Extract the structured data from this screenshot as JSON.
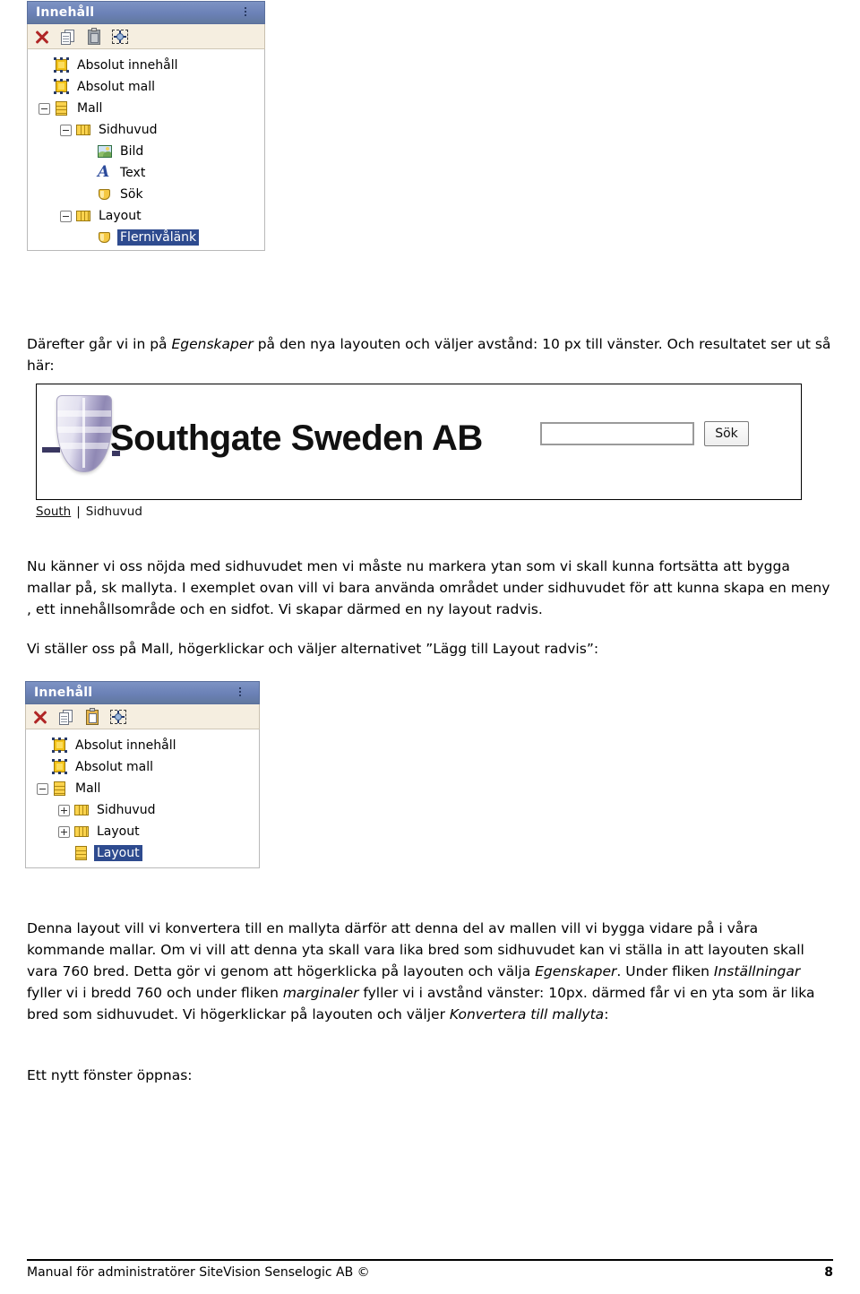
{
  "document": {
    "footer_text": "Manual för administratörer SiteVision Senselogic AB ©",
    "page_number": "8"
  },
  "tree_panel_1": {
    "title": "Innehåll",
    "toolbar": {
      "delete_tooltip": "Ta bort",
      "copy_tooltip": "Kopiera",
      "paste_tooltip": "Klistra in",
      "move_tooltip": "Flytta"
    },
    "nodes": [
      {
        "label": "Absolut innehåll",
        "icon": "absolute-element-icon",
        "indent": 0,
        "toggle": "none",
        "selected": false
      },
      {
        "label": "Absolut mall",
        "icon": "absolute-element-icon",
        "indent": 0,
        "toggle": "none",
        "selected": false
      },
      {
        "label": "Mall",
        "icon": "rows-layout-icon",
        "indent": 0,
        "toggle": "minus",
        "selected": false
      },
      {
        "label": "Sidhuvud",
        "icon": "columns-layout-icon",
        "indent": 1,
        "toggle": "minus",
        "selected": false
      },
      {
        "label": "Bild",
        "icon": "image-module-icon",
        "indent": 2,
        "toggle": "none",
        "selected": false
      },
      {
        "label": "Text",
        "icon": "text-module-icon",
        "indent": 2,
        "toggle": "none",
        "selected": false
      },
      {
        "label": "Sök",
        "icon": "module-icon",
        "indent": 2,
        "toggle": "none",
        "selected": false
      },
      {
        "label": "Layout",
        "icon": "columns-layout-icon",
        "indent": 1,
        "toggle": "minus",
        "selected": false
      },
      {
        "label": "Flernivålänk",
        "icon": "module-icon",
        "indent": 2,
        "toggle": "none",
        "selected": true
      }
    ]
  },
  "paragraph_1": {
    "parts": [
      {
        "text": "Därefter går vi in på ",
        "style": "normal"
      },
      {
        "text": "Egenskaper",
        "style": "italic"
      },
      {
        "text": " på den nya layouten och väljer avstånd: 10 px till vänster. Och resultatet ser ut så här:",
        "style": "normal"
      }
    ]
  },
  "preview": {
    "logo_icon": "shield-logo-icon",
    "site_title": "Southgate Sweden AB",
    "search_value": "",
    "search_placeholder": "",
    "search_button_label": "Sök",
    "breadcrumb": {
      "link": "South",
      "separator": "|",
      "current": "Sidhuvud"
    }
  },
  "paragraph_2": {
    "text": "Nu känner vi oss nöjda med sidhuvudet men vi måste nu markera ytan som vi skall kunna fortsätta att bygga mallar på, sk mallyta. I exemplet ovan vill vi bara använda området under sidhuvudet för att kunna skapa en meny , ett innehållsområde och en sidfot. Vi skapar därmed en ny layout radvis."
  },
  "paragraph_3": {
    "text": "Vi ställer oss på Mall, högerklickar och väljer alternativet ”Lägg till Layout radvis”:"
  },
  "tree_panel_2": {
    "title": "Innehåll",
    "toolbar": {
      "delete_tooltip": "Ta bort",
      "copy_tooltip": "Kopiera",
      "paste_tooltip": "Klistra in",
      "move_tooltip": "Flytta"
    },
    "nodes": [
      {
        "label": "Absolut innehåll",
        "icon": "absolute-element-icon",
        "indent": 0,
        "toggle": "none",
        "selected": false
      },
      {
        "label": "Absolut mall",
        "icon": "absolute-element-icon",
        "indent": 0,
        "toggle": "none",
        "selected": false
      },
      {
        "label": "Mall",
        "icon": "rows-layout-icon",
        "indent": 0,
        "toggle": "minus",
        "selected": false
      },
      {
        "label": "Sidhuvud",
        "icon": "columns-layout-icon",
        "indent": 1,
        "toggle": "plus",
        "selected": false
      },
      {
        "label": "Layout",
        "icon": "columns-layout-icon",
        "indent": 1,
        "toggle": "plus",
        "selected": false
      },
      {
        "label": "Layout",
        "icon": "rows-layout-icon",
        "indent": 1,
        "toggle": "none",
        "selected": true
      }
    ]
  },
  "paragraph_4": {
    "parts": [
      {
        "text": "Denna layout vill vi konvertera till en mallyta därför att denna del av mallen vill vi bygga vidare på i våra kommande mallar. Om vi vill att denna yta skall vara lika bred som sidhuvudet kan vi ställa in att layouten skall vara 760 bred. Detta gör vi genom att högerklicka på layouten och välja ",
        "style": "normal"
      },
      {
        "text": "Egenskaper",
        "style": "italic"
      },
      {
        "text": ". Under fliken ",
        "style": "normal"
      },
      {
        "text": "Inställningar",
        "style": "italic"
      },
      {
        "text": " fyller vi i bredd 760 och under fliken ",
        "style": "normal"
      },
      {
        "text": "marginaler",
        "style": "italic"
      },
      {
        "text": " fyller vi i avstånd vänster: 10px. därmed får vi en yta som är lika bred som sidhuvudet. Vi högerklickar på layouten och väljer ",
        "style": "normal"
      },
      {
        "text": "Konvertera till mallyta",
        "style": "italic"
      },
      {
        "text": ":",
        "style": "normal"
      }
    ]
  },
  "paragraph_5": {
    "text": "Ett nytt fönster öppnas:"
  }
}
